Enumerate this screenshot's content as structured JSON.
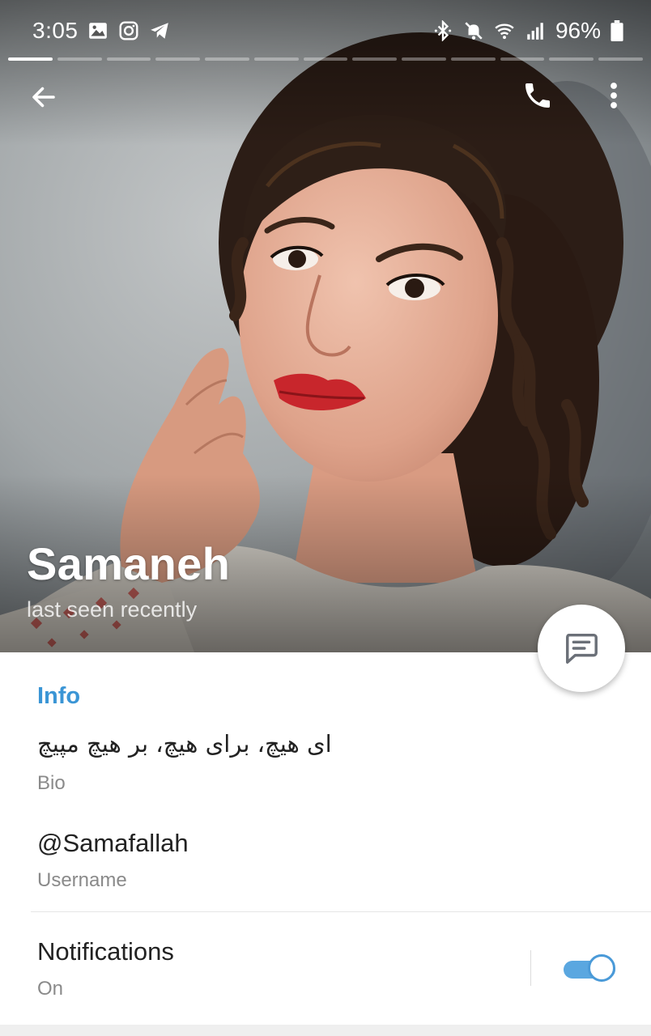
{
  "status_bar": {
    "time": "3:05",
    "left_icons": [
      "image-icon",
      "instagram-icon",
      "telegram-icon"
    ],
    "right_icons": [
      "bluetooth-icon",
      "mute-icon",
      "wifi-icon",
      "signal-icon",
      "battery-icon"
    ],
    "battery": "96%"
  },
  "story": {
    "segments": 13,
    "active_segment": 1
  },
  "toolbar": {
    "back_icon": "arrow-left-icon",
    "call_icon": "phone-icon",
    "more_icon": "more-vertical-icon"
  },
  "profile": {
    "name": "Samaneh",
    "status": "last seen recently",
    "photo_icon": "profile-photo"
  },
  "fab": {
    "icon": "message-icon"
  },
  "info": {
    "title": "Info",
    "bio_value": "ای هیچ، برای هیچ، بر هیچ مپیچ",
    "bio_label": "Bio",
    "username_value": "@Samafallah",
    "username_label": "Username",
    "notifications_label": "Notifications",
    "notifications_value": "On",
    "notifications_enabled": true
  },
  "colors": {
    "accent": "#3a95d5",
    "toggle_track": "#5aa7e0",
    "text_primary": "#222222",
    "text_secondary": "#8a8a8a"
  }
}
